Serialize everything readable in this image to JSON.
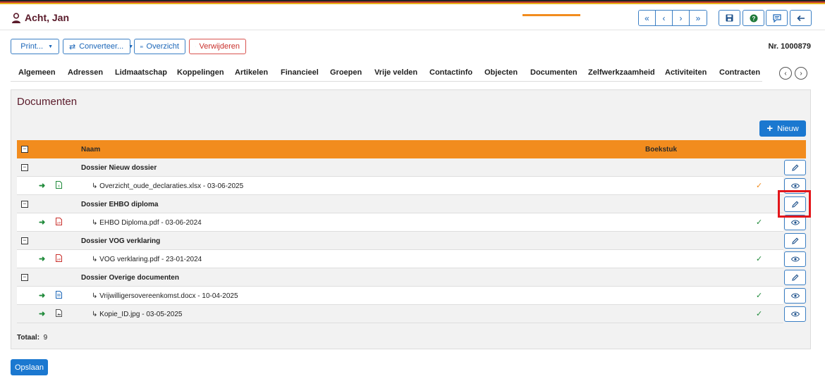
{
  "header": {
    "title": "Acht, Jan",
    "icons": [
      "user-icon",
      "first-page-icon",
      "prev-icon",
      "next-icon",
      "last-page-icon",
      "save-icon",
      "help-icon",
      "message-icon",
      "back-icon"
    ]
  },
  "toolbar": {
    "print_label": "Print...",
    "converteer_label": "Converteer...",
    "overzicht_label": "Overzicht",
    "verwijderen_label": "Verwijderen"
  },
  "record_number": "Nr. 1000879",
  "tabs": [
    {
      "label": "Algemeen"
    },
    {
      "label": "Adressen"
    },
    {
      "label": "Lidmaatschap"
    },
    {
      "label": "Koppelingen"
    },
    {
      "label": "Artikelen"
    },
    {
      "label": "Financieel"
    },
    {
      "label": "Groepen"
    },
    {
      "label": "Vrije velden"
    },
    {
      "label": "Contactinfo"
    },
    {
      "label": "Objecten"
    },
    {
      "label": "Documenten"
    },
    {
      "label": "Zelfwerkzaamheid"
    },
    {
      "label": "Activiteiten"
    },
    {
      "label": "Contracten"
    }
  ],
  "active_tab": "Documenten",
  "panel": {
    "title": "Documenten",
    "new_button": "Nieuw",
    "columns": {
      "naam": "Naam",
      "boekstuk": "Boekstuk"
    },
    "groups": [
      {
        "name": "Dossier Nieuw dossier",
        "files": [
          {
            "name": "Overzicht_oude_declaraties.xlsx - 03-06-2025",
            "type": "xlsx",
            "check_color": "#f28c1e"
          }
        ]
      },
      {
        "name": "Dossier EHBO diploma",
        "files": [
          {
            "name": "EHBO Diploma.pdf - 03-06-2024",
            "type": "pdf",
            "check_color": "#1f8a3a"
          }
        ]
      },
      {
        "name": "Dossier VOG verklaring",
        "files": [
          {
            "name": "VOG verklaring.pdf - 23-01-2024",
            "type": "pdf",
            "check_color": "#1f8a3a"
          }
        ]
      },
      {
        "name": "Dossier Overige documenten",
        "files": [
          {
            "name": "Vrijwilligersovereenkomst.docx - 10-04-2025",
            "type": "docx",
            "check_color": "#1f8a3a"
          },
          {
            "name": "Kopie_ID.jpg - 03-05-2025",
            "type": "jpg",
            "check_color": "#1f8a3a"
          }
        ]
      }
    ],
    "totaal_label": "Totaal:",
    "totaal_value": "9"
  },
  "save_button": "Opslaan",
  "colors": {
    "accent_orange": "#f28c1e",
    "primary_blue": "#1b78d0",
    "title_maroon": "#5a1a2a",
    "check_green": "#1f8a3a",
    "highlight_red": "#e3161b"
  }
}
